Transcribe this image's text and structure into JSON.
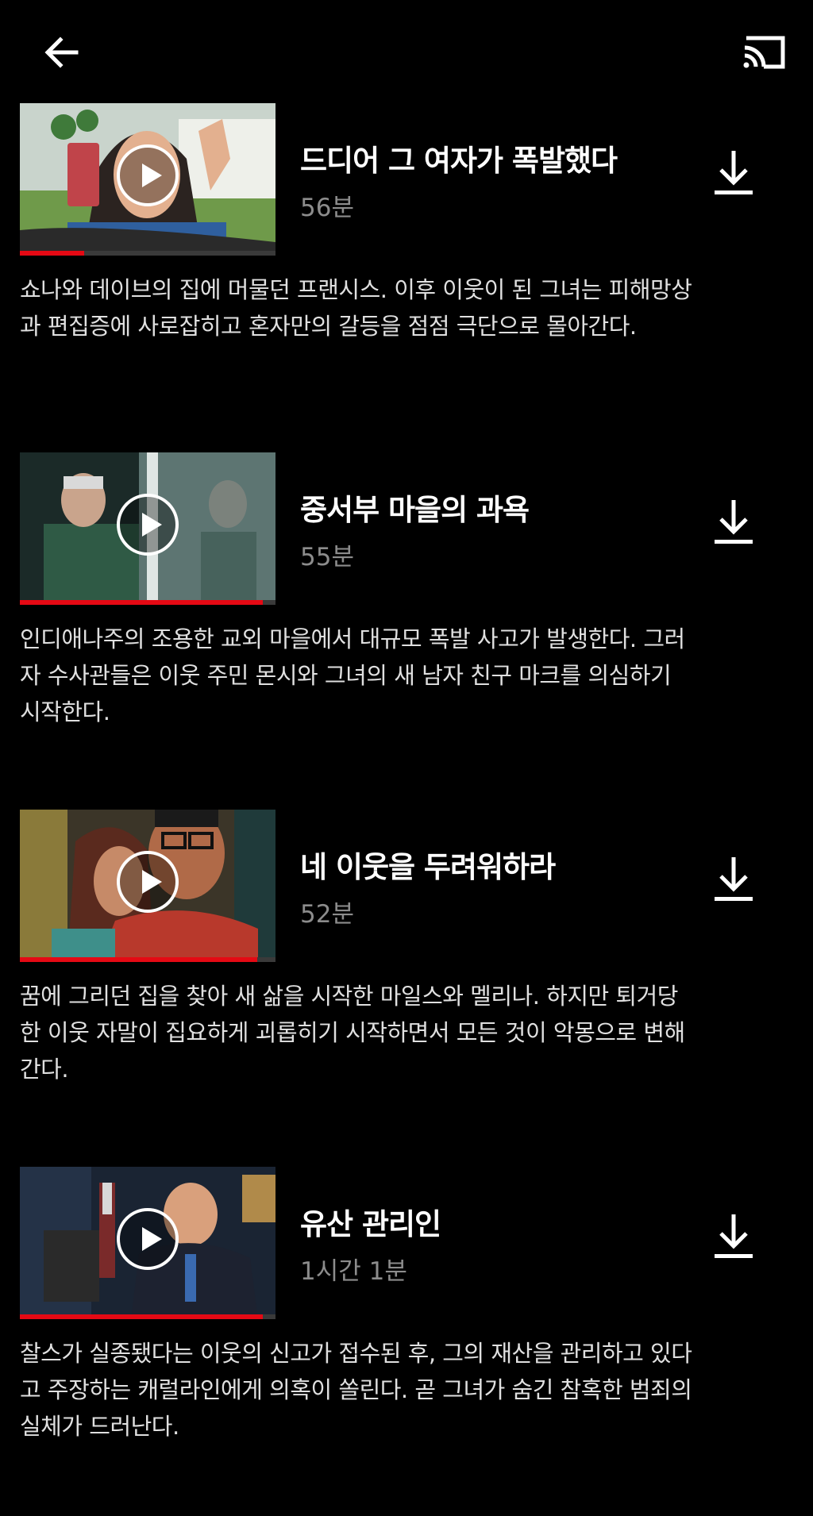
{
  "header": {
    "back_icon": "arrow-left-icon",
    "cast_icon": "cast-icon"
  },
  "colors": {
    "background": "#000000",
    "progress": "#e50914",
    "duration_text": "#8c8c8c"
  },
  "episodes": [
    {
      "title": "드디어 그 여자가 폭발했다",
      "duration": "56분",
      "progress": 0.25,
      "description": "쇼나와 데이브의 집에 머물던 프랜시스. 이후 이웃이 된 그녀는 피해망상과 편집증에 사로잡히고 혼자만의 갈등을 점점 극단으로 몰아간다."
    },
    {
      "title": "중서부 마을의 과욕",
      "duration": "55분",
      "progress": 0.95,
      "description": "인디애나주의 조용한 교외 마을에서 대규모 폭발 사고가 발생한다. 그러자 수사관들은 이웃 주민 몬시와 그녀의 새 남자 친구 마크를 의심하기 시작한다."
    },
    {
      "title": "네 이웃을 두려워하라",
      "duration": "52분",
      "progress": 0.93,
      "description": "꿈에 그리던 집을 찾아 새 삶을 시작한 마일스와 멜리나. 하지만 퇴거당한 이웃 자말이 집요하게 괴롭히기 시작하면서 모든 것이 악몽으로 변해 간다."
    },
    {
      "title": "유산 관리인",
      "duration": "1시간 1분",
      "progress": 0.95,
      "description": "찰스가 실종됐다는 이웃의 신고가 접수된 후, 그의 재산을 관리하고 있다고 주장하는 캐럴라인에게 의혹이 쏠린다. 곧 그녀가 숨긴 참혹한 범죄의 실체가 드러난다."
    }
  ]
}
